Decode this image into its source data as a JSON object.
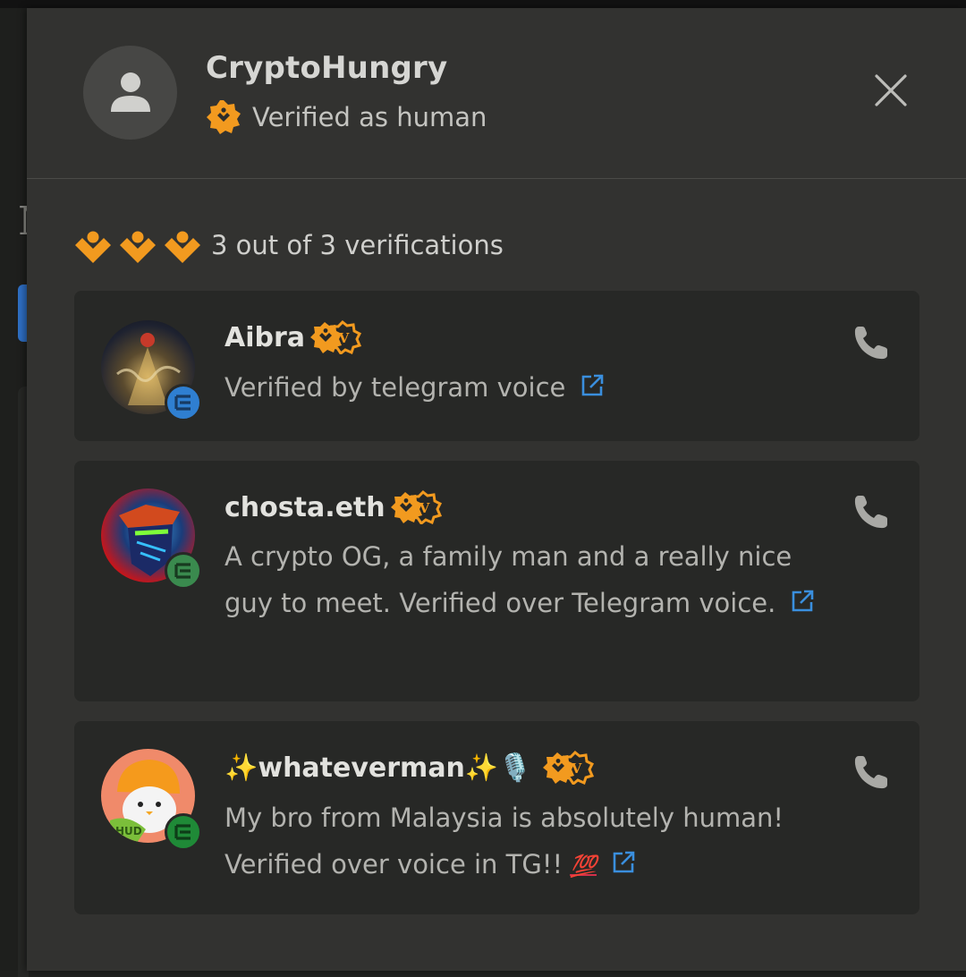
{
  "profile": {
    "name": "CryptoHungry",
    "status": "Verified as human",
    "avatar_icon": "user-silhouette-icon",
    "close_icon": "close-icon"
  },
  "summary": {
    "text": "3 out of 3 verifications",
    "filled_count": 3,
    "total_count": 3
  },
  "verifications": [
    {
      "name": "Aibra",
      "description": "Verified by telegram voice",
      "badge_color": "#2f7fd1"
    },
    {
      "name": "chosta.eth",
      "description": "A crypto OG, a family man and a really nice guy to meet. Verified over Telegram voice.",
      "badge_color": "#3a8a4e"
    },
    {
      "name": "✨whateverman✨🎙️",
      "description": "My bro from Malaysia is absolutely human! Verified over voice in TG!!",
      "emoji": "💯",
      "badge_color": "#1f8a37"
    }
  ],
  "colors": {
    "accent_orange": "#f29a1f",
    "link_blue": "#3a8fde",
    "panel_bg": "#323230",
    "card_bg": "#272826"
  }
}
